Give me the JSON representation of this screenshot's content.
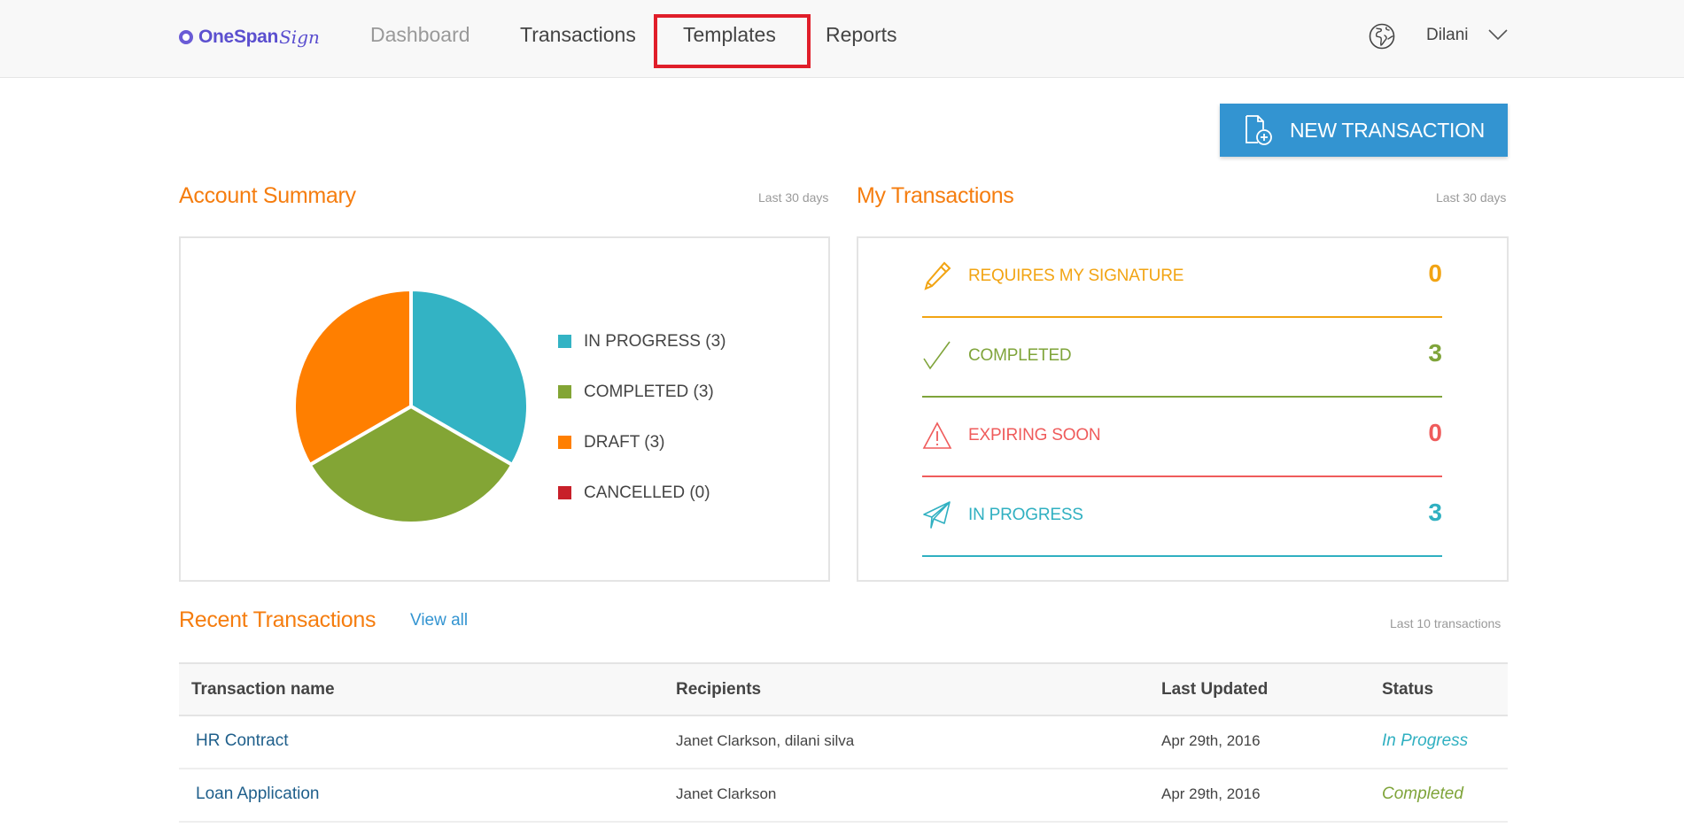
{
  "header": {
    "logo_text": "OneSpan",
    "logo_script": "Sign",
    "nav": [
      {
        "label": "Dashboard",
        "state": "current"
      },
      {
        "label": "Transactions"
      },
      {
        "label": "Templates",
        "highlighted": true
      },
      {
        "label": "Reports"
      }
    ],
    "user_name": "Dilani",
    "icons": {
      "language": "globe-icon",
      "user_menu": "chevron-down-icon"
    }
  },
  "new_transaction_button": {
    "label": "NEW TRANSACTION",
    "icon": "document-plus-icon",
    "color": "#3394d1"
  },
  "account_summary": {
    "title": "Account Summary",
    "period": "Last 30 days"
  },
  "my_transactions": {
    "title": "My Transactions",
    "period": "Last 30 days",
    "items": [
      {
        "label": "REQUIRES MY SIGNATURE",
        "count": "0",
        "icon": "pen-icon",
        "color": "#f2a413"
      },
      {
        "label": "COMPLETED",
        "count": "3",
        "icon": "checkmark-icon",
        "color": "#7fa43a"
      },
      {
        "label": "EXPIRING SOON",
        "count": "0",
        "icon": "warning-icon",
        "color": "#ef5b5b"
      },
      {
        "label": "IN PROGRESS",
        "count": "3",
        "icon": "paper-plane-icon",
        "color": "#30b0c1"
      }
    ]
  },
  "recent_transactions": {
    "title": "Recent Transactions",
    "view_all": "View all",
    "subtitle": "Last 10 transactions",
    "columns": [
      "Transaction name",
      "Recipients",
      "Last Updated",
      "Status"
    ],
    "rows": [
      {
        "name": "HR Contract",
        "recipients": "Janet Clarkson, dilani silva",
        "updated": "Apr 29th, 2016",
        "status": "In Progress",
        "status_color": "#30b0c1"
      },
      {
        "name": "Loan Application",
        "recipients": "Janet Clarkson",
        "updated": "Apr 29th, 2016",
        "status": "Completed",
        "status_color": "#7fa43a"
      }
    ]
  },
  "chart_data": {
    "type": "pie",
    "title": "Account Summary",
    "categories": [
      "IN PROGRESS",
      "COMPLETED",
      "DRAFT",
      "CANCELLED"
    ],
    "values": [
      3,
      3,
      3,
      0
    ],
    "colors": [
      "#33b3c4",
      "#83a535",
      "#ff7f00",
      "#c8202a"
    ],
    "legend_labels": [
      "IN PROGRESS (3)",
      "COMPLETED (3)",
      "DRAFT (3)",
      "CANCELLED (0)"
    ],
    "legend": "right"
  }
}
